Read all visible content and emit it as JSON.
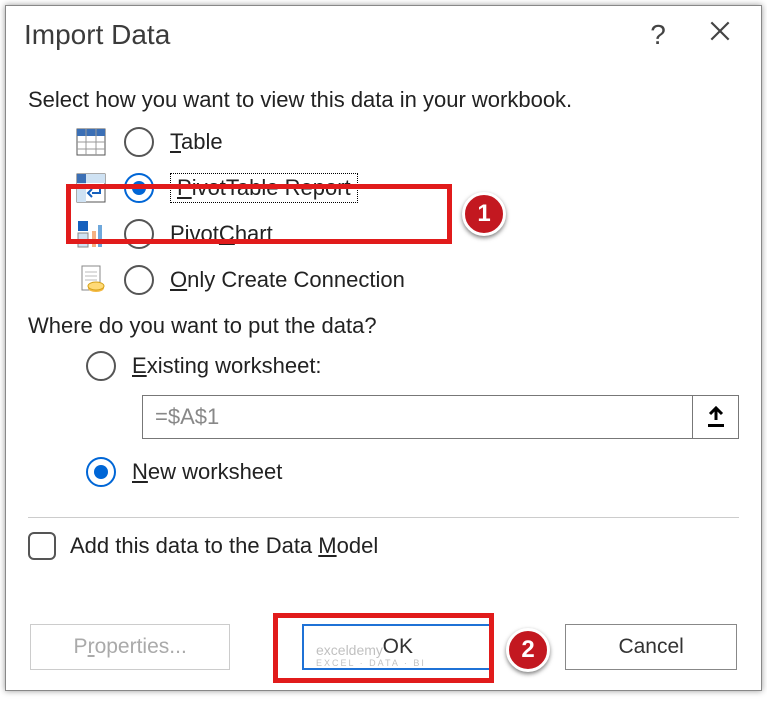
{
  "title": "Import Data",
  "intro": "Select how you want to view this data in your workbook.",
  "view_options": {
    "table": "Table",
    "pivottable": "PivotTable Report",
    "pivotchart": "PivotChart",
    "only_connection": "Only Create Connection"
  },
  "selected_view": "pivottable",
  "location_prompt": "Where do you want to put the data?",
  "location_options": {
    "existing": "Existing worksheet:",
    "new": "New worksheet"
  },
  "selected_location": "new",
  "cell_ref": "=$A$1",
  "add_to_model": "Add this data to the Data Model",
  "add_to_model_checked": false,
  "buttons": {
    "properties": "Properties...",
    "ok": "OK",
    "cancel": "Cancel"
  },
  "callouts": {
    "one": "1",
    "two": "2"
  },
  "watermark": {
    "main": "exceldemy",
    "sub": "EXCEL · DATA · BI"
  }
}
